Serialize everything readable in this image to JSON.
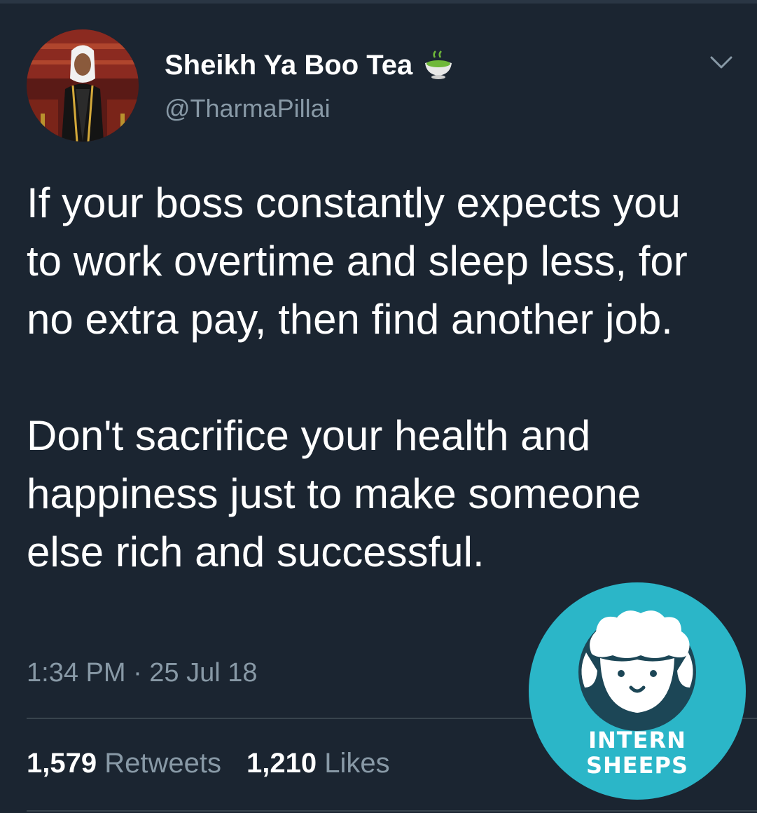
{
  "tweet": {
    "display_name": "Sheikh Ya Boo Tea",
    "handle": "@TharmaPillai",
    "name_emoji": "tea-cup-icon",
    "body_paragraphs": [
      "If your boss constantly expects you to work overtime and sleep less, for no extra pay, then find another job.",
      "Don't sacrifice your health and happiness just to make someone else rich and successful."
    ],
    "timestamp": "1:34 PM · 25 Jul 18",
    "stats": {
      "retweets_count": "1,579",
      "retweets_label": "Retweets",
      "likes_count": "1,210",
      "likes_label": "Likes"
    }
  },
  "watermark": {
    "line1": "INTERN",
    "line2": "SHEEPS"
  },
  "colors": {
    "background": "#1b2531",
    "text_primary": "#ffffff",
    "text_secondary": "#8899a6",
    "divider": "#38444d",
    "watermark_bg": "#2bb6c8",
    "watermark_dark": "#1c4656"
  },
  "icons": {
    "menu": "chevron-down-icon",
    "avatar": "profile-avatar"
  }
}
